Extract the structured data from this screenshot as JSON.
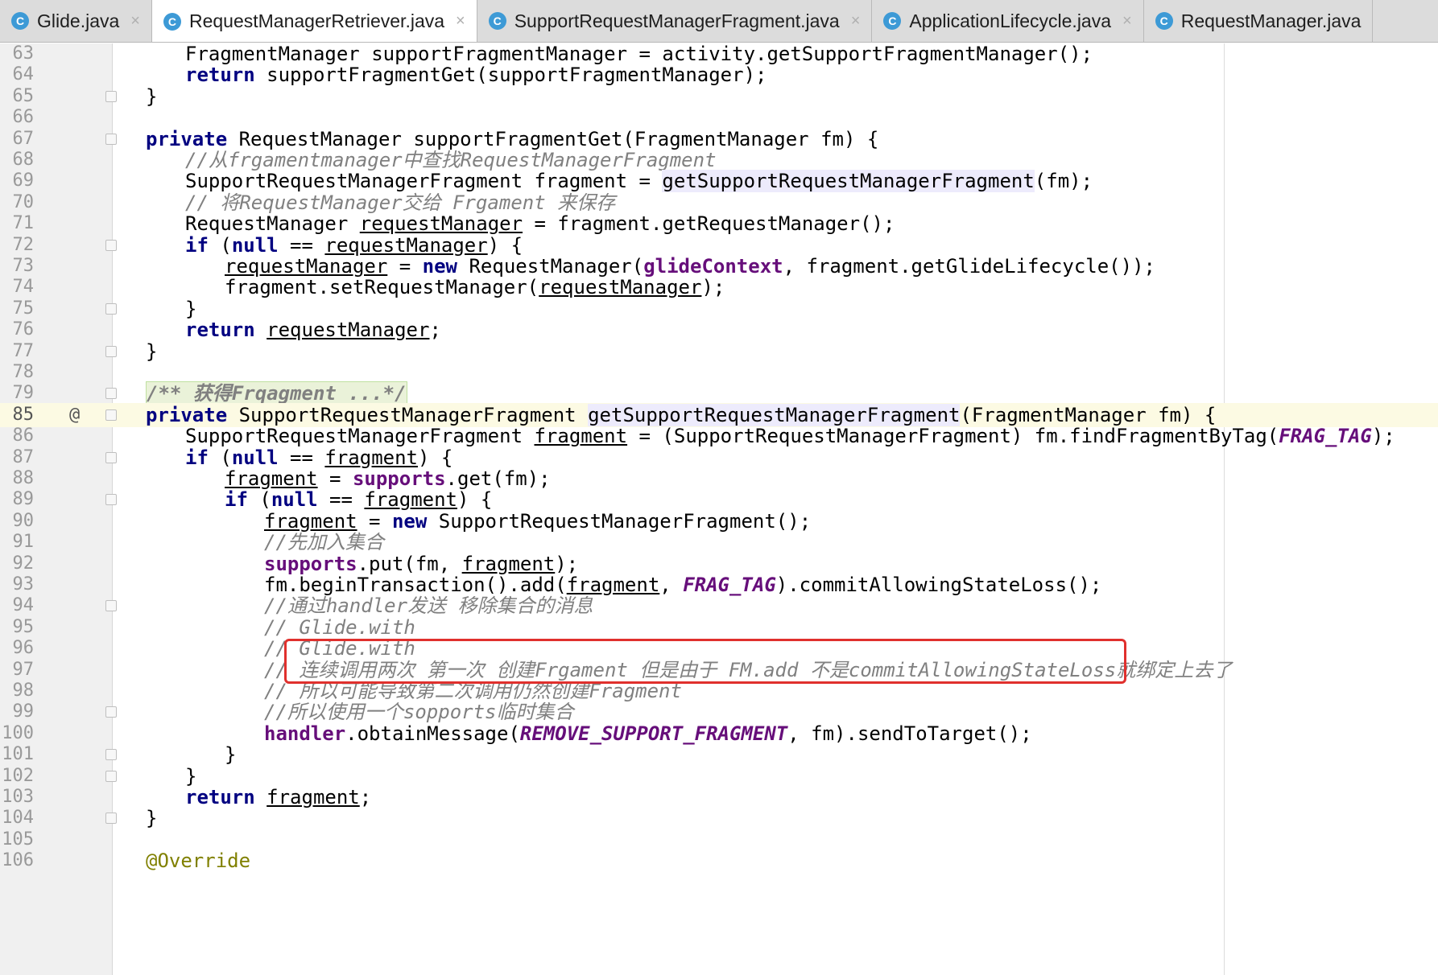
{
  "tabs": [
    {
      "label": "Glide.java",
      "icon": "C",
      "active": false
    },
    {
      "label": "RequestManagerRetriever.java",
      "icon": "C",
      "active": true
    },
    {
      "label": "SupportRequestManagerFragment.java",
      "icon": "C",
      "active": false
    },
    {
      "label": "ApplicationLifecycle.java",
      "icon": "C",
      "active": false
    },
    {
      "label": "RequestManager.java",
      "icon": "C",
      "active": false
    }
  ],
  "close_glyph": "×",
  "colors": {
    "keyword": "#000080",
    "comment": "#808080",
    "field": "#660e7a",
    "highlight_box": "#e0302d"
  },
  "editor": {
    "lines": [
      {
        "n": "63",
        "indent": 2,
        "parts": [
          {
            "t": "FragmentManager supportFragmentManager = activity.getSupportFragmentManager();"
          }
        ]
      },
      {
        "n": "64",
        "indent": 2,
        "parts": [
          {
            "t": "return",
            "c": "kw"
          },
          {
            "t": " supportFragmentGet(supportFragmentManager);"
          }
        ]
      },
      {
        "n": "65",
        "indent": 1,
        "fold": true,
        "parts": [
          {
            "t": "}"
          }
        ]
      },
      {
        "n": "66",
        "indent": 0,
        "parts": []
      },
      {
        "n": "67",
        "indent": 1,
        "fold": true,
        "parts": [
          {
            "t": "private",
            "c": "kw"
          },
          {
            "t": " RequestManager supportFragmentGet(FragmentManager fm) {"
          }
        ]
      },
      {
        "n": "68",
        "indent": 2,
        "parts": [
          {
            "t": "//从frgamentmanager中查找RequestManagerFragment",
            "c": "cm"
          }
        ]
      },
      {
        "n": "69",
        "indent": 2,
        "parts": [
          {
            "t": "SupportRequestManagerFragment fragment = "
          },
          {
            "t": "getSupportRequestManagerFragment",
            "c": "hl"
          },
          {
            "t": "(fm);"
          }
        ]
      },
      {
        "n": "70",
        "indent": 2,
        "parts": [
          {
            "t": "// 将RequestManager交给 Frgament 来保存",
            "c": "cm"
          }
        ]
      },
      {
        "n": "71",
        "indent": 2,
        "parts": [
          {
            "t": "RequestManager "
          },
          {
            "t": "requestManager",
            "c": "uvar"
          },
          {
            "t": " = fragment.getRequestManager();"
          }
        ]
      },
      {
        "n": "72",
        "indent": 2,
        "fold": true,
        "parts": [
          {
            "t": "if",
            "c": "kw"
          },
          {
            "t": " ("
          },
          {
            "t": "null",
            "c": "kw"
          },
          {
            "t": " == "
          },
          {
            "t": "requestManager",
            "c": "uvar"
          },
          {
            "t": ") {"
          }
        ]
      },
      {
        "n": "73",
        "indent": 3,
        "parts": [
          {
            "t": "requestManager",
            "c": "uvar"
          },
          {
            "t": " = "
          },
          {
            "t": "new",
            "c": "kw"
          },
          {
            "t": " RequestManager("
          },
          {
            "t": "glideContext",
            "c": "field"
          },
          {
            "t": ", fragment.getGlideLifecycle());"
          }
        ]
      },
      {
        "n": "74",
        "indent": 3,
        "parts": [
          {
            "t": "fragment.setRequestManager("
          },
          {
            "t": "requestManager",
            "c": "uvar"
          },
          {
            "t": ");"
          }
        ]
      },
      {
        "n": "75",
        "indent": 2,
        "fold": true,
        "parts": [
          {
            "t": "}"
          }
        ]
      },
      {
        "n": "76",
        "indent": 2,
        "parts": [
          {
            "t": "return",
            "c": "kw"
          },
          {
            "t": " "
          },
          {
            "t": "requestManager",
            "c": "uvar"
          },
          {
            "t": ";"
          }
        ]
      },
      {
        "n": "77",
        "indent": 1,
        "fold": true,
        "parts": [
          {
            "t": "}"
          }
        ]
      },
      {
        "n": "78",
        "indent": 0,
        "parts": []
      },
      {
        "n": "79",
        "indent": 1,
        "fold": true,
        "parts": [
          {
            "t": "/** 获得Frqagment ...*/",
            "c": "doc"
          }
        ]
      },
      {
        "n": "85",
        "indent": 1,
        "fold": true,
        "current": true,
        "marker": "@",
        "parts": [
          {
            "t": "private",
            "c": "kw"
          },
          {
            "t": " SupportRequestManagerFragment "
          },
          {
            "t": "getSupportRequestManagerFragment",
            "c": "hl"
          },
          {
            "t": "(FragmentManager fm) {"
          }
        ]
      },
      {
        "n": "86",
        "indent": 2,
        "parts": [
          {
            "t": "SupportRequestManagerFragment "
          },
          {
            "t": "fragment",
            "c": "uvar"
          },
          {
            "t": " = (SupportRequestManagerFragment) fm.findFragmentByTag("
          },
          {
            "t": "FRAG_TAG",
            "c": "const"
          },
          {
            "t": ");"
          }
        ]
      },
      {
        "n": "87",
        "indent": 2,
        "fold": true,
        "parts": [
          {
            "t": "if",
            "c": "kw"
          },
          {
            "t": " ("
          },
          {
            "t": "null",
            "c": "kw"
          },
          {
            "t": " == "
          },
          {
            "t": "fragment",
            "c": "uvar"
          },
          {
            "t": ") {"
          }
        ]
      },
      {
        "n": "88",
        "indent": 3,
        "parts": [
          {
            "t": "fragment",
            "c": "uvar"
          },
          {
            "t": " = "
          },
          {
            "t": "supports",
            "c": "field"
          },
          {
            "t": ".get(fm);"
          }
        ]
      },
      {
        "n": "89",
        "indent": 3,
        "fold": true,
        "parts": [
          {
            "t": "if",
            "c": "kw"
          },
          {
            "t": " ("
          },
          {
            "t": "null",
            "c": "kw"
          },
          {
            "t": " == "
          },
          {
            "t": "fragment",
            "c": "uvar"
          },
          {
            "t": ") {"
          }
        ]
      },
      {
        "n": "90",
        "indent": 4,
        "parts": [
          {
            "t": "fragment",
            "c": "uvar"
          },
          {
            "t": " = "
          },
          {
            "t": "new",
            "c": "kw"
          },
          {
            "t": " SupportRequestManagerFragment();"
          }
        ]
      },
      {
        "n": "91",
        "indent": 4,
        "parts": [
          {
            "t": "//先加入集合",
            "c": "cm"
          }
        ]
      },
      {
        "n": "92",
        "indent": 4,
        "parts": [
          {
            "t": "supports",
            "c": "field"
          },
          {
            "t": ".put(fm, "
          },
          {
            "t": "fragment",
            "c": "uvar"
          },
          {
            "t": ");"
          }
        ]
      },
      {
        "n": "93",
        "indent": 4,
        "parts": [
          {
            "t": "fm.beginTransaction().add("
          },
          {
            "t": "fragment",
            "c": "uvar"
          },
          {
            "t": ", "
          },
          {
            "t": "FRAG_TAG",
            "c": "const"
          },
          {
            "t": ").commitAllowingStateLoss();"
          }
        ]
      },
      {
        "n": "94",
        "indent": 4,
        "fold": true,
        "parts": [
          {
            "t": "//通过handler发送 移除集合的消息",
            "c": "cm"
          }
        ]
      },
      {
        "n": "95",
        "indent": 4,
        "parts": [
          {
            "t": "// Glide.with",
            "c": "cm"
          }
        ]
      },
      {
        "n": "96",
        "indent": 4,
        "parts": [
          {
            "t": "// Glide.with",
            "c": "cm"
          }
        ]
      },
      {
        "n": "97",
        "indent": 4,
        "parts": [
          {
            "t": "// 连续调用两次 第一次 创建Frgament 但是由于 FM.add 不是commitAllowingStateLoss就绑定上去了",
            "c": "cm"
          }
        ]
      },
      {
        "n": "98",
        "indent": 4,
        "parts": [
          {
            "t": "// 所以可能导致第二次调用仍然创建Fragment",
            "c": "cm"
          }
        ]
      },
      {
        "n": "99",
        "indent": 4,
        "fold": true,
        "parts": [
          {
            "t": "//所以使用一个sopports临时集合",
            "c": "cm"
          }
        ]
      },
      {
        "n": "100",
        "indent": 4,
        "parts": [
          {
            "t": "handler",
            "c": "field"
          },
          {
            "t": ".obtainMessage("
          },
          {
            "t": "REMOVE_SUPPORT_FRAGMENT",
            "c": "const"
          },
          {
            "t": ", fm).sendToTarget();"
          }
        ]
      },
      {
        "n": "101",
        "indent": 3,
        "fold": true,
        "parts": [
          {
            "t": "}"
          }
        ]
      },
      {
        "n": "102",
        "indent": 2,
        "fold": true,
        "parts": [
          {
            "t": "}"
          }
        ]
      },
      {
        "n": "103",
        "indent": 2,
        "parts": [
          {
            "t": "return",
            "c": "kw"
          },
          {
            "t": " "
          },
          {
            "t": "fragment",
            "c": "uvar"
          },
          {
            "t": ";"
          }
        ]
      },
      {
        "n": "104",
        "indent": 1,
        "fold": true,
        "parts": [
          {
            "t": "}"
          }
        ]
      },
      {
        "n": "105",
        "indent": 0,
        "parts": []
      },
      {
        "n": "106",
        "indent": 1,
        "parts": [
          {
            "t": "@Override",
            "c": "ann"
          }
        ]
      }
    ]
  }
}
